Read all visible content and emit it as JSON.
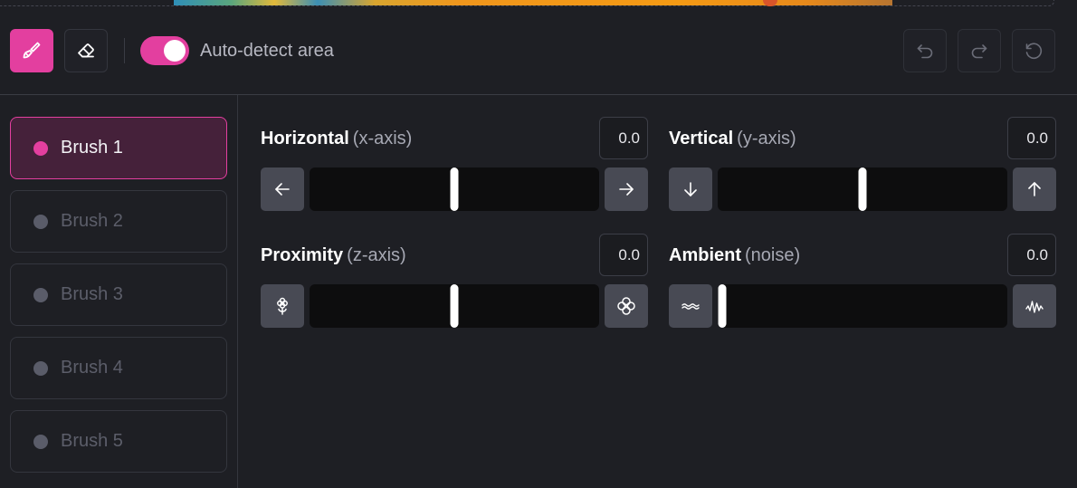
{
  "toolbar": {
    "brush_tool": "paintbrush-icon",
    "eraser_tool": "eraser-icon",
    "auto_detect": {
      "label": "Auto-detect area",
      "enabled": true
    },
    "undo": "undo-icon",
    "redo": "redo-icon",
    "reset": "reset-icon"
  },
  "brushes": [
    {
      "label": "Brush 1",
      "active": true
    },
    {
      "label": "Brush 2",
      "active": false
    },
    {
      "label": "Brush 3",
      "active": false
    },
    {
      "label": "Brush 4",
      "active": false
    },
    {
      "label": "Brush 5",
      "active": false
    }
  ],
  "controls": {
    "horizontal": {
      "title": "Horizontal",
      "subtitle": "(x-axis)",
      "value": "0.0",
      "level": 0.5,
      "left_icon": "arrow-left-icon",
      "right_icon": "arrow-right-icon"
    },
    "vertical": {
      "title": "Vertical",
      "subtitle": "(y-axis)",
      "value": "0.0",
      "level": 0.5,
      "left_icon": "arrow-down-icon",
      "right_icon": "arrow-up-icon"
    },
    "proximity": {
      "title": "Proximity",
      "subtitle": "(z-axis)",
      "value": "0.0",
      "level": 0.5,
      "left_icon": "flower-small-icon",
      "right_icon": "flower-large-icon"
    },
    "ambient": {
      "title": "Ambient",
      "subtitle": "(noise)",
      "value": "0.0",
      "level": 0.0,
      "left_icon": "wave-low-icon",
      "right_icon": "wave-high-icon"
    }
  },
  "colors": {
    "accent": "#e33f9f",
    "background": "#1e1f24",
    "track": "#0d0d0e",
    "button": "#484a54"
  }
}
